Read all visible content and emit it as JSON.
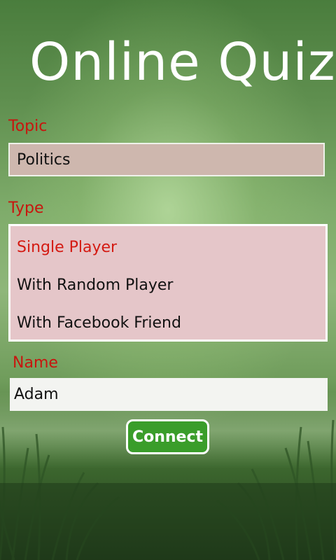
{
  "title": "Online Quiz",
  "topic": {
    "label": "Topic",
    "value": "Politics"
  },
  "type": {
    "label": "Type",
    "options": [
      "Single Player",
      "With Random Player",
      "With Facebook Friend"
    ],
    "selected": "Single Player"
  },
  "name": {
    "label": "Name",
    "value": "Adam"
  },
  "connect_label": "Connect",
  "colors": {
    "label_red": "#c8150e",
    "selected_red": "#d41a12",
    "topic_bg": "#ceb7ae",
    "type_bg": "#e5c6c9",
    "button_green": "#3a9d2a"
  }
}
